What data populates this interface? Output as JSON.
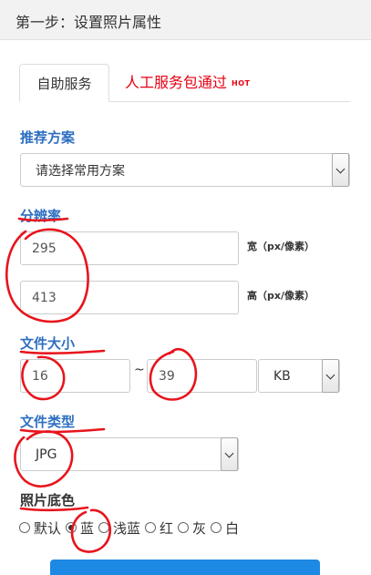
{
  "header": {
    "title": "第一步：设置照片属性"
  },
  "tabs": [
    {
      "label": "自助服务",
      "active": true
    },
    {
      "label": "人工服务包通过",
      "badge": "HOT",
      "color": "#e60012"
    }
  ],
  "scheme": {
    "label": "推荐方案",
    "select_value": "请选择常用方案"
  },
  "resolution": {
    "label": "分辨率",
    "width_value": "295",
    "width_unit": "宽（px/像素）",
    "height_value": "413",
    "height_unit": "高（px/像素）"
  },
  "file_size": {
    "label": "文件大小",
    "min_value": "16",
    "separator": "~",
    "max_value": "39",
    "unit_select": "KB"
  },
  "file_type": {
    "label": "文件类型",
    "select_value": "JPG"
  },
  "background": {
    "label": "照片底色",
    "options": [
      {
        "label": "默认",
        "checked": false
      },
      {
        "label": "蓝",
        "checked": true
      },
      {
        "label": "浅蓝",
        "checked": false
      },
      {
        "label": "红",
        "checked": false
      },
      {
        "label": "灰",
        "checked": false
      },
      {
        "label": "白",
        "checked": false
      }
    ]
  },
  "colors": {
    "section_label": "#2e6fc1",
    "hot_red": "#e60012",
    "annotation_red": "#e8141c",
    "button_blue": "#1e88e5"
  }
}
